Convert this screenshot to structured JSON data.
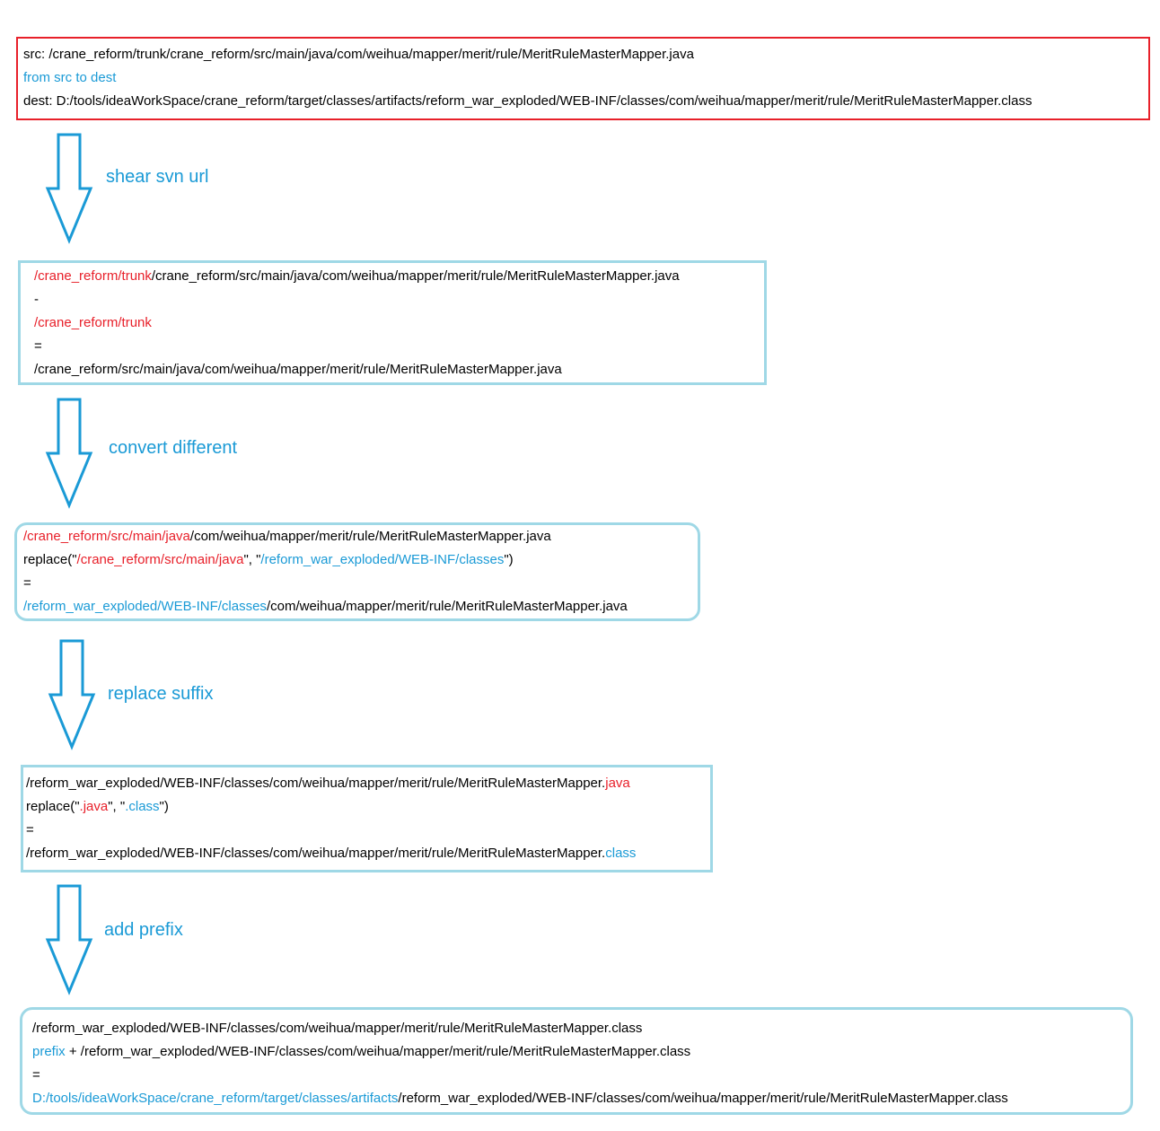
{
  "box1": {
    "src": "src: /crane_reform/trunk/crane_reform/src/main/java/com/weihua/mapper/merit/rule/MeritRuleMasterMapper.java",
    "from": "from src to dest",
    "dest": "dest: D:/tools/ideaWorkSpace/crane_reform/target/classes/artifacts/reform_war_exploded/WEB-INF/classes/com/weihua/mapper/merit/rule/MeritRuleMasterMapper.class"
  },
  "step1": "shear svn url",
  "box2": {
    "l1_red": "/crane_reform/trunk",
    "l1_rest": "/crane_reform/src/main/java/com/weihua/mapper/merit/rule/MeritRuleMasterMapper.java",
    "l2": "-",
    "l3_red": "/crane_reform/trunk",
    "l4": "=",
    "l5": "/crane_reform/src/main/java/com/weihua/mapper/merit/rule/MeritRuleMasterMapper.java"
  },
  "step2": "convert different",
  "box3": {
    "l1_red": "/crane_reform/src/main/java",
    "l1_rest": "/com/weihua/mapper/merit/rule/MeritRuleMasterMapper.java",
    "l2_a": "replace(\"",
    "l2_red": "/crane_reform/src/main/java",
    "l2_b": "\", \"",
    "l2_blue": "/reform_war_exploded/WEB-INF/classes",
    "l2_c": "\")",
    "l3": "=",
    "l4_blue": "/reform_war_exploded/WEB-INF/classes",
    "l4_rest": "/com/weihua/mapper/merit/rule/MeritRuleMasterMapper.java"
  },
  "step3": "replace suffix",
  "box4": {
    "l1_rest": "/reform_war_exploded/WEB-INF/classes/com/weihua/mapper/merit/rule/MeritRuleMasterMapper.",
    "l1_red": "java",
    "l2_a": "replace(\"",
    "l2_red": ".java",
    "l2_b": "\", \"",
    "l2_blue": ".class",
    "l2_c": "\")",
    "l3": "=",
    "l4_rest": "/reform_war_exploded/WEB-INF/classes/com/weihua/mapper/merit/rule/MeritRuleMasterMapper.",
    "l4_blue": "class"
  },
  "step4": "add prefix",
  "box5": {
    "l1": "/reform_war_exploded/WEB-INF/classes/com/weihua/mapper/merit/rule/MeritRuleMasterMapper.class",
    "l2_blue": "prefix",
    "l2_rest": " + /reform_war_exploded/WEB-INF/classes/com/weihua/mapper/merit/rule/MeritRuleMasterMapper.class",
    "l3": "=",
    "l4_blue": "D:/tools/ideaWorkSpace/crane_reform/target/classes/artifacts",
    "l4_rest": "/reform_war_exploded/WEB-INF/classes/com/weihua/mapper/merit/rule/MeritRuleMasterMapper.class"
  },
  "colors": {
    "red": "#e8202a",
    "blue": "#1a9ad6",
    "box_border": "#9fd8e6",
    "arrow": "#1a9ad6"
  }
}
